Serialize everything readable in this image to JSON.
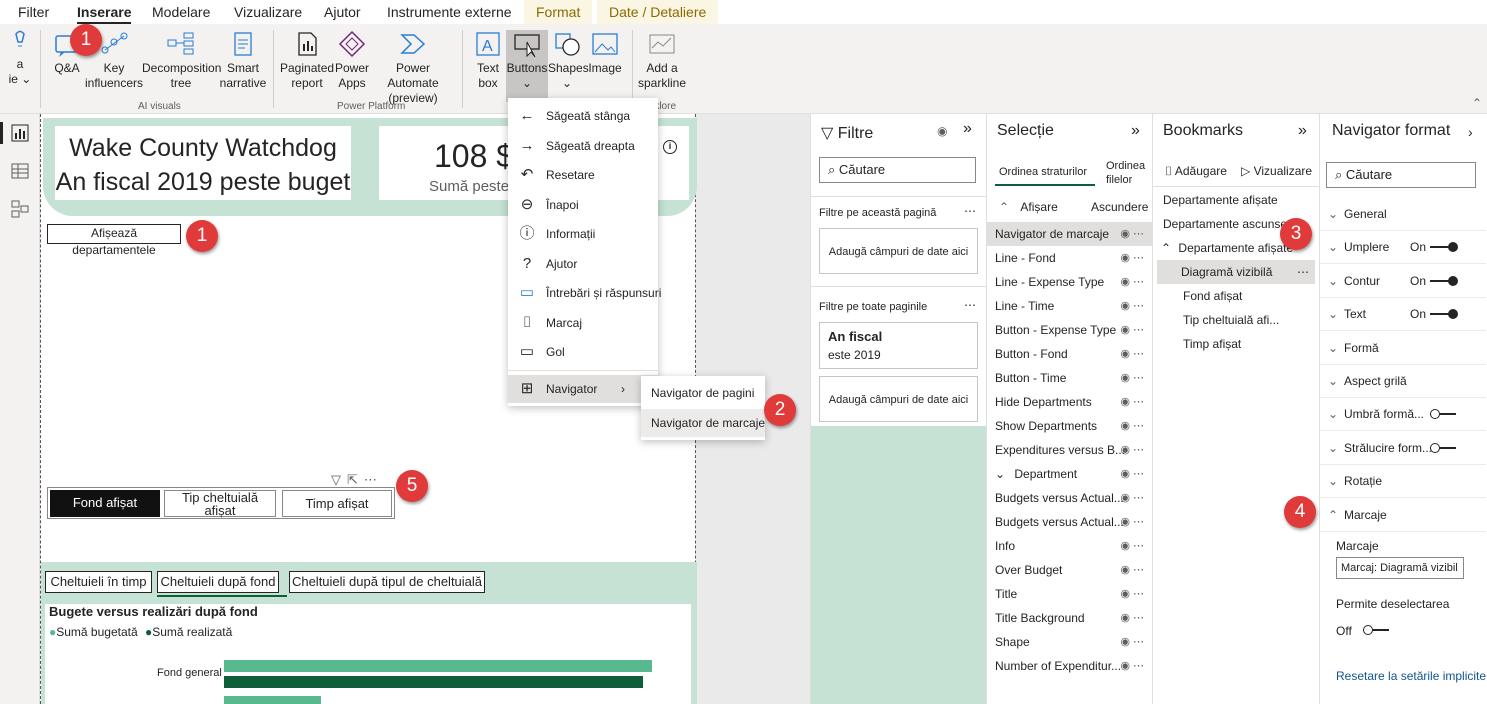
{
  "menubar": {
    "tabs": [
      "Filter",
      "Inserare",
      "Modelare",
      "Vizualizare",
      "Ajutor",
      "Instrumente externe",
      "Format",
      "Date / Detaliere"
    ]
  },
  "ribbon": {
    "left_partial_1": "a",
    "left_partial_2": "ie",
    "buttons": {
      "qa": "Q&A",
      "key_1": "Key",
      "key_2": "influencers",
      "decomp_1": "Decomposition",
      "decomp_2": "tree",
      "smart_1": "Smart",
      "smart_2": "narrative",
      "pag_1": "Paginated",
      "pag_2": "report",
      "papps_1": "Power",
      "papps_2": "Apps",
      "pauto_1": "Power Automate",
      "pauto_2": "(preview)",
      "text_1": "Text",
      "text_2": "box",
      "buttons": "Buttons",
      "shapes": "Shapes",
      "image": "Image",
      "spark_1": "Add a",
      "spark_2": "sparkline"
    },
    "groups": {
      "ai": "AI visuals",
      "pp": "Power Platform",
      "spark": "rklore"
    }
  },
  "buttons_menu": {
    "items": [
      "Săgeată stânga",
      "Săgeată dreapta",
      "Resetare",
      "Înapoi",
      "Informații",
      "Ajutor",
      "Întrebări și răspunsuri",
      "Marcaj",
      "Gol",
      "Navigator"
    ]
  },
  "submenu": {
    "items": [
      "Navigator de pagini",
      "Navigator de marcaje"
    ]
  },
  "badges": {
    "b1": "1",
    "b2": "2",
    "b3": "3",
    "b4": "4",
    "b5": "5"
  },
  "report": {
    "title_line1": "Wake County Watchdog",
    "title_line2": "An fiscal 2019 peste buget",
    "kpi_value": "108 $",
    "kpi_label": "Sumă peste",
    "show_dept": "Afișează departamentele",
    "nav_buttons": [
      "Fond afișat",
      "Tip cheltuială afișat",
      "Timp afișat"
    ],
    "chart_tabs": [
      "Cheltuieli în timp",
      "Cheltuieli după fond",
      "Cheltuieli după tipul de cheltuială"
    ],
    "chart_title": "Bugete versus realizări după fond",
    "legend": [
      "Sumă bugetată",
      "Sumă realizată"
    ],
    "category": "Fond general"
  },
  "chart_data": {
    "type": "bar",
    "title": "Bugete versus realizări după fond",
    "categories": [
      "Fond general"
    ],
    "series": [
      {
        "name": "Sumă bugetată",
        "values": [
          0.95
        ]
      },
      {
        "name": "Sumă realizată",
        "values": [
          0.93
        ]
      }
    ]
  },
  "filters": {
    "title": "Filtre",
    "search": "Căutare",
    "this_page": "Filtre pe această pagină",
    "add_fields": "Adaugă câmpuri de date aici",
    "all_pages": "Filtre pe toate paginile",
    "card_title": "An fiscal",
    "card_value": "este 2019",
    "add_fields2": "Adaugă câmpuri de date aici"
  },
  "selection": {
    "title": "Selecție",
    "tab1": "Ordinea straturilor",
    "tab2_1": "Ordinea",
    "tab2_2": "filelor",
    "show": "Afișare",
    "sort": "Ascundere",
    "items": [
      "Navigator de marcaje",
      "Line - Fond",
      "Line - Expense Type",
      "Line - Time",
      "Button -  Expense Type",
      "Button - Fond",
      "Button - Time",
      "Hide Departments",
      "Show Departments",
      "Expenditures versus B...",
      "Department",
      "Budgets versus Actual...",
      "Budgets versus Actual...",
      "Info",
      "Over Budget",
      "Title",
      "Title Background",
      "Shape",
      "Number of Expenditur..."
    ]
  },
  "bookmarks": {
    "title": "Bookmarks",
    "add": "Adăugare",
    "view": "Vizualizare",
    "items": [
      "Departamente afișate",
      "Departamente ascunse",
      "Departamente afișate",
      "Diagramă vizibilă",
      "Fond afișat",
      "Tip cheltuială afi...",
      "Timp afișat"
    ]
  },
  "format": {
    "title": "Navigator format",
    "search": "Căutare",
    "rows": [
      "General",
      "Umplere",
      "Contur",
      "Text",
      "Formă",
      "Aspect grilă",
      "Umbră formă...",
      "Strălucire form...",
      "Rotație",
      "Marcaje"
    ],
    "on": "On",
    "off": "Off",
    "marcaje_label": "Marcaje",
    "marcaje_value": "Marcaj: Diagramă vizibil",
    "deselect": "Permite deselectarea",
    "reset": "Resetare la setările implicite"
  }
}
